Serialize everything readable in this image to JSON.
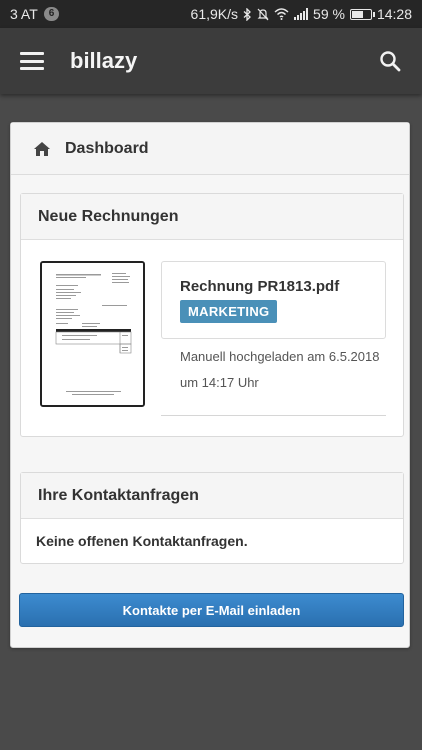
{
  "status_bar": {
    "carrier": "3 AT",
    "notification_count": "6",
    "network_speed": "61,9K/s",
    "battery_percent": "59 %",
    "battery_level": 0.59,
    "time": "14:28"
  },
  "app_bar": {
    "title": "billazy"
  },
  "dashboard": {
    "title": "Dashboard"
  },
  "invoices": {
    "heading": "Neue Rechnungen",
    "items": [
      {
        "file_name": "Rechnung PR1813.pdf",
        "tag": "MARKETING",
        "upload_line1": "Manuell hochgeladen am 6.5.2018",
        "upload_line2": "um 14:17 Uhr"
      }
    ]
  },
  "contacts": {
    "heading": "Ihre Kontaktanfragen",
    "empty_text": "Keine offenen Kontaktanfragen."
  },
  "actions": {
    "invite_label": "Kontakte per E-Mail einladen"
  },
  "colors": {
    "tag_bg": "#4a90b8",
    "button_bg": "#2f7bbf",
    "appbar_bg": "#3c3c3c"
  }
}
